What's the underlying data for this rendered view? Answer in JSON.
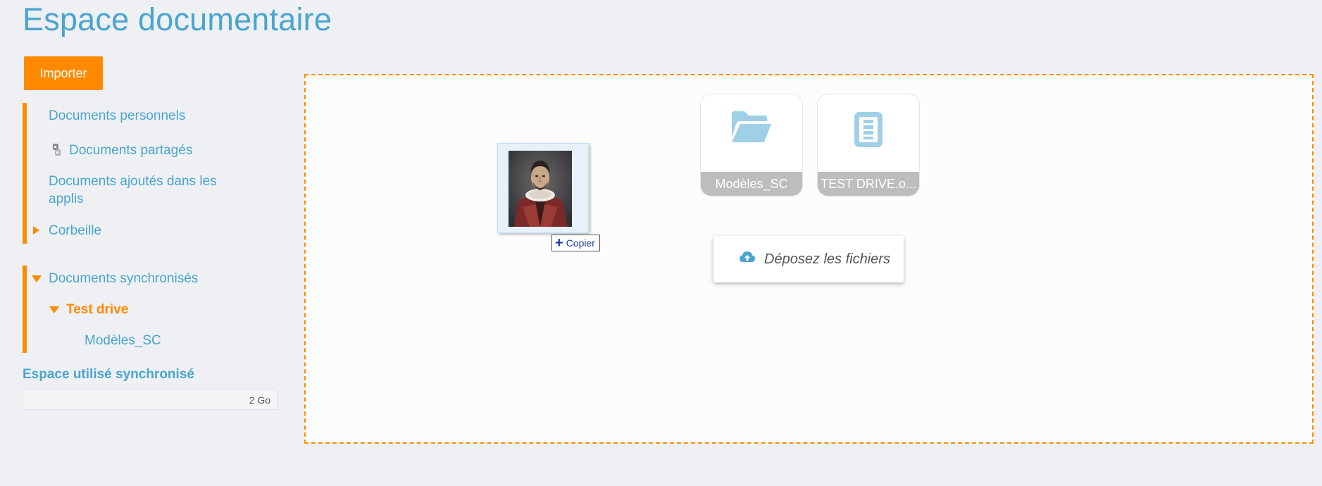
{
  "header": {
    "title": "Espace documentaire"
  },
  "toolbar": {
    "import_label": "Importer"
  },
  "sidebar": {
    "group1": [
      {
        "label": "Documents personnels",
        "icon": "none"
      },
      {
        "label": "Documents partagés",
        "icon": "share-icon"
      },
      {
        "label": "Documents ajoutés dans les applis"
      },
      {
        "label": "Corbeille",
        "icon": "caret-right-icon"
      }
    ],
    "group2": [
      {
        "label": "Documents synchronisés",
        "icon": "caret-down-icon"
      },
      {
        "label": "Test drive",
        "icon": "caret-down-icon",
        "active": true
      },
      {
        "label": "Modèles_SC"
      }
    ]
  },
  "usage": {
    "label": "Espace utilisé synchronisé",
    "capacity": "2 Go",
    "used_fraction": 0
  },
  "main": {
    "tiles": [
      {
        "label": "Modèles_SC",
        "icon": "folder-open-icon"
      },
      {
        "label": "TEST DRIVE.o...",
        "icon": "document-icon"
      }
    ],
    "drag": {
      "copy_label": "Copier",
      "image_subject": "portrait-image"
    },
    "drop_hint": "Déposez les fichiers"
  },
  "colors": {
    "accent": "#ff8a00",
    "link": "#4aa5cf",
    "tile_label_bg": "#bdbdbd",
    "icon_blue": "#9fd0e8"
  }
}
